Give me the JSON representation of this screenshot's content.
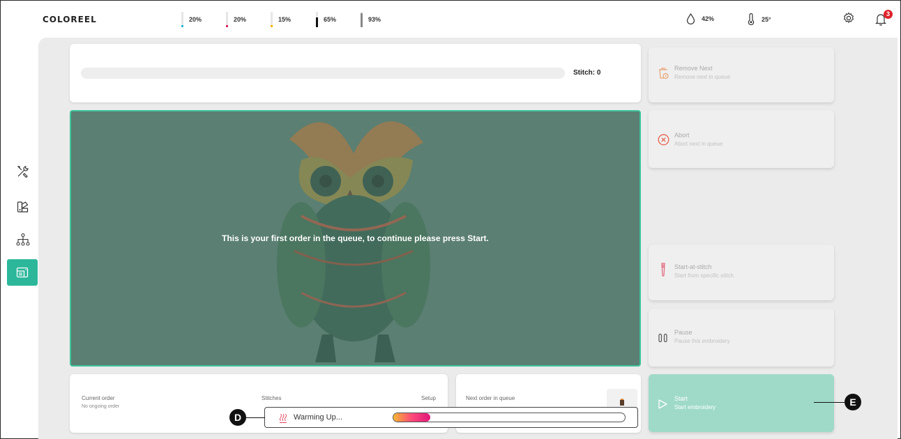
{
  "header": {
    "logo": "COLOREEL",
    "inks": [
      {
        "name": "cyan-ink",
        "pct": "20%",
        "color": "#29b7d3",
        "level": 0.2
      },
      {
        "name": "magenta-ink",
        "pct": "20%",
        "color": "#e0215e",
        "level": 0.2
      },
      {
        "name": "yellow-ink",
        "pct": "15%",
        "color": "#f4b400",
        "level": 0.15
      },
      {
        "name": "black-ink",
        "pct": "65%",
        "color": "#111111",
        "level": 0.65
      },
      {
        "name": "clear-ink",
        "pct": "93%",
        "color": "#888888",
        "level": 0.93
      }
    ],
    "humidity": "42%",
    "temperature": "25°",
    "notification_count": "3"
  },
  "progress": {
    "stitch_label": "Stitch: 0",
    "value": 0
  },
  "preview": {
    "message": "This is your first order in the queue, to continue please press Start."
  },
  "actions": {
    "remove_next": {
      "title": "Remove Next",
      "subtitle": "Remove next in queue"
    },
    "abort": {
      "title": "Abort",
      "subtitle": "Abort next in queue"
    },
    "start_at_stitch": {
      "title": "Start-at-stitch",
      "subtitle": "Start from specific stitch"
    },
    "pause": {
      "title": "Pause",
      "subtitle": "Pause this embroidery"
    },
    "start": {
      "title": "Start",
      "subtitle": "Start embroidery"
    }
  },
  "current_order": {
    "label": "Current order",
    "value": "No ongoing order",
    "stitches_label": "Stitches",
    "setup_label": "Setup"
  },
  "next_order": {
    "label": "Next order in queue"
  },
  "warming": {
    "label": "Warming Up...",
    "progress": 0.16
  },
  "callouts": {
    "d": "D",
    "e": "E"
  },
  "colors": {
    "accent": "#2cb79b",
    "start_bg": "#9fdac8",
    "panel_bg": "#ebebeb"
  }
}
